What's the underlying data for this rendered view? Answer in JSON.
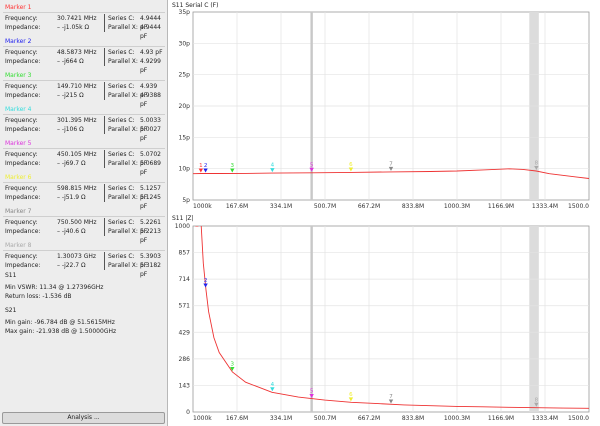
{
  "markers": [
    {
      "title": "Marker 1",
      "color": "#ff3333",
      "freq_label": "Frequency:",
      "freq": "30.7421 MHz",
      "imp_label": "Impedance:",
      "imp": "– -j1.05k Ω",
      "series_label": "Series C:",
      "series": "4.9444 pF",
      "parallel_label": "Parallel X:",
      "parallel": "4.9444 pF"
    },
    {
      "title": "Marker 2",
      "color": "#2222ee",
      "freq_label": "Frequency:",
      "freq": "48.5873 MHz",
      "imp_label": "Impedance:",
      "imp": "– -j664 Ω",
      "series_label": "Series C:",
      "series": "4.93 pF",
      "parallel_label": "Parallel X:",
      "parallel": "4.9299 pF"
    },
    {
      "title": "Marker 3",
      "color": "#33dd33",
      "freq_label": "Frequency:",
      "freq": "149.710 MHz",
      "imp_label": "Impedance:",
      "imp": "– -j215 Ω",
      "series_label": "Series C:",
      "series": "4.939 pF",
      "parallel_label": "Parallel X:",
      "parallel": "4.9388 pF"
    },
    {
      "title": "Marker 4",
      "color": "#33dddd",
      "freq_label": "Frequency:",
      "freq": "301.395 MHz",
      "imp_label": "Impedance:",
      "imp": "– -j106 Ω",
      "series_label": "Series C:",
      "series": "5.0033 pF",
      "parallel_label": "Parallel X:",
      "parallel": "5.0027 pF"
    },
    {
      "title": "Marker 5",
      "color": "#dd33dd",
      "freq_label": "Frequency:",
      "freq": "450.105 MHz",
      "imp_label": "Impedance:",
      "imp": "– -j69.7 Ω",
      "series_label": "Series C:",
      "series": "5.0702 pF",
      "parallel_label": "Parallel X:",
      "parallel": "5.0689 pF"
    },
    {
      "title": "Marker 6",
      "color": "#eeee33",
      "freq_label": "Frequency:",
      "freq": "598.815 MHz",
      "imp_label": "Impedance:",
      "imp": "– -j51.9 Ω",
      "series_label": "Series C:",
      "series": "5.1257 pF",
      "parallel_label": "Parallel X:",
      "parallel": "5.1245 pF"
    },
    {
      "title": "Marker 7",
      "color": "#888888",
      "freq_label": "Frequency:",
      "freq": "750.500 MHz",
      "imp_label": "Impedance:",
      "imp": "– -j40.6 Ω",
      "series_label": "Series C:",
      "series": "5.2261 pF",
      "parallel_label": "Parallel X:",
      "parallel": "5.2213 pF"
    },
    {
      "title": "Marker 8",
      "color": "#aaaaaa",
      "freq_label": "Frequency:",
      "freq": "1.30073 GHz",
      "imp_label": "Impedance:",
      "imp": "– -j22.7 Ω",
      "series_label": "Series C:",
      "series": "5.3903 pF",
      "parallel_label": "Parallel X:",
      "parallel": "5.3182 pF"
    }
  ],
  "s11_section": {
    "title": "S11",
    "vswr": "Min VSWR:  11.34 @ 1.27396GHz",
    "return_loss": "Return loss:  -1.536 dB"
  },
  "s21_section": {
    "title": "S21",
    "min_gain": "Min gain:  -96.784 dB @ 51.5615MHz",
    "max_gain": "Max gain:  -21.938 dB @ 1.50000GHz"
  },
  "analysis_button": "Analysis ...",
  "plots": {
    "top_title": "S11  Serial C  (F)",
    "bottom_title": "S11  |Z|"
  },
  "chart_data": [
    {
      "type": "line",
      "title": "S11  Serial C  (F)",
      "x_tick_labels": [
        "1000k",
        "167.6M",
        "334.1M",
        "500.7M",
        "667.2M",
        "833.8M",
        "1000.3M",
        "1166.9M",
        "1333.4M",
        "1500.0"
      ],
      "y_tick_labels": [
        "35p",
        "30p",
        "25p",
        "20p",
        "15p",
        "10p",
        "5p"
      ],
      "xlim": [
        1,
        1500
      ],
      "ylim": [
        0,
        35
      ],
      "x_unit": "MHz",
      "series": [
        {
          "color": "#ee3333",
          "x": [
            1,
            30,
            100,
            200,
            300,
            450,
            600,
            750,
            900,
            1000,
            1100,
            1200,
            1250,
            1300,
            1350,
            1400,
            1450,
            1500
          ],
          "y": [
            4.9,
            4.94,
            4.94,
            4.95,
            5.0,
            5.07,
            5.13,
            5.23,
            5.3,
            5.4,
            5.6,
            5.8,
            5.7,
            5.4,
            4.9,
            4.6,
            4.3,
            4.0
          ]
        }
      ],
      "markers": [
        {
          "label": "1",
          "x": 30.7421,
          "y": 4.94,
          "color": "#ff3333"
        },
        {
          "label": "2",
          "x": 48.5873,
          "y": 4.93,
          "color": "#2222ee"
        },
        {
          "label": "3",
          "x": 149.71,
          "y": 4.94,
          "color": "#33dd33"
        },
        {
          "label": "4",
          "x": 301.395,
          "y": 5.0,
          "color": "#33dddd"
        },
        {
          "label": "5",
          "x": 450.105,
          "y": 5.07,
          "color": "#dd33dd"
        },
        {
          "label": "6",
          "x": 598.815,
          "y": 5.13,
          "color": "#eeee33"
        },
        {
          "label": "7",
          "x": 750.5,
          "y": 5.23,
          "color": "#888888"
        },
        {
          "label": "8",
          "x": 1300.73,
          "y": 5.39,
          "color": "#aaaaaa"
        }
      ],
      "cursor_x": 450.105,
      "shaded_band": [
        1274,
        1310
      ],
      "grid": true
    },
    {
      "type": "line",
      "title": "S11  |Z|",
      "x_tick_labels": [
        "1000k",
        "167.6M",
        "334.1M",
        "500.7M",
        "667.2M",
        "833.8M",
        "1000.3M",
        "1166.9M",
        "1333.4M",
        "1500.0"
      ],
      "y_tick_labels": [
        "1000",
        "857",
        "714",
        "571",
        "429",
        "286",
        "143",
        "0"
      ],
      "xlim": [
        1,
        1500
      ],
      "ylim": [
        0,
        1000
      ],
      "x_unit": "MHz",
      "series": [
        {
          "color": "#ee3333",
          "x": [
            10,
            20,
            30,
            40,
            50,
            60,
            80,
            100,
            150,
            200,
            300,
            400,
            500,
            600,
            700,
            800,
            900,
            1000,
            1100,
            1200,
            1300,
            1400,
            1500
          ],
          "y": [
            1000,
            1000,
            1050,
            800,
            660,
            540,
            400,
            320,
            215,
            160,
            106,
            80,
            64,
            52,
            45,
            38,
            34,
            30,
            28,
            25,
            23,
            21,
            20
          ]
        }
      ],
      "markers": [
        {
          "label": "2",
          "x": 48.5873,
          "y": 664,
          "color": "#2222ee"
        },
        {
          "label": "3",
          "x": 149.71,
          "y": 215,
          "color": "#33dd33"
        },
        {
          "label": "4",
          "x": 301.395,
          "y": 106,
          "color": "#33dddd"
        },
        {
          "label": "5",
          "x": 450.105,
          "y": 69.7,
          "color": "#dd33dd"
        },
        {
          "label": "6",
          "x": 598.815,
          "y": 51.9,
          "color": "#eeee33"
        },
        {
          "label": "7",
          "x": 750.5,
          "y": 40.6,
          "color": "#888888"
        },
        {
          "label": "8",
          "x": 1300.73,
          "y": 22.7,
          "color": "#aaaaaa"
        }
      ],
      "cursor_x": 450.105,
      "shaded_band": [
        1274,
        1310
      ],
      "grid": true
    }
  ]
}
